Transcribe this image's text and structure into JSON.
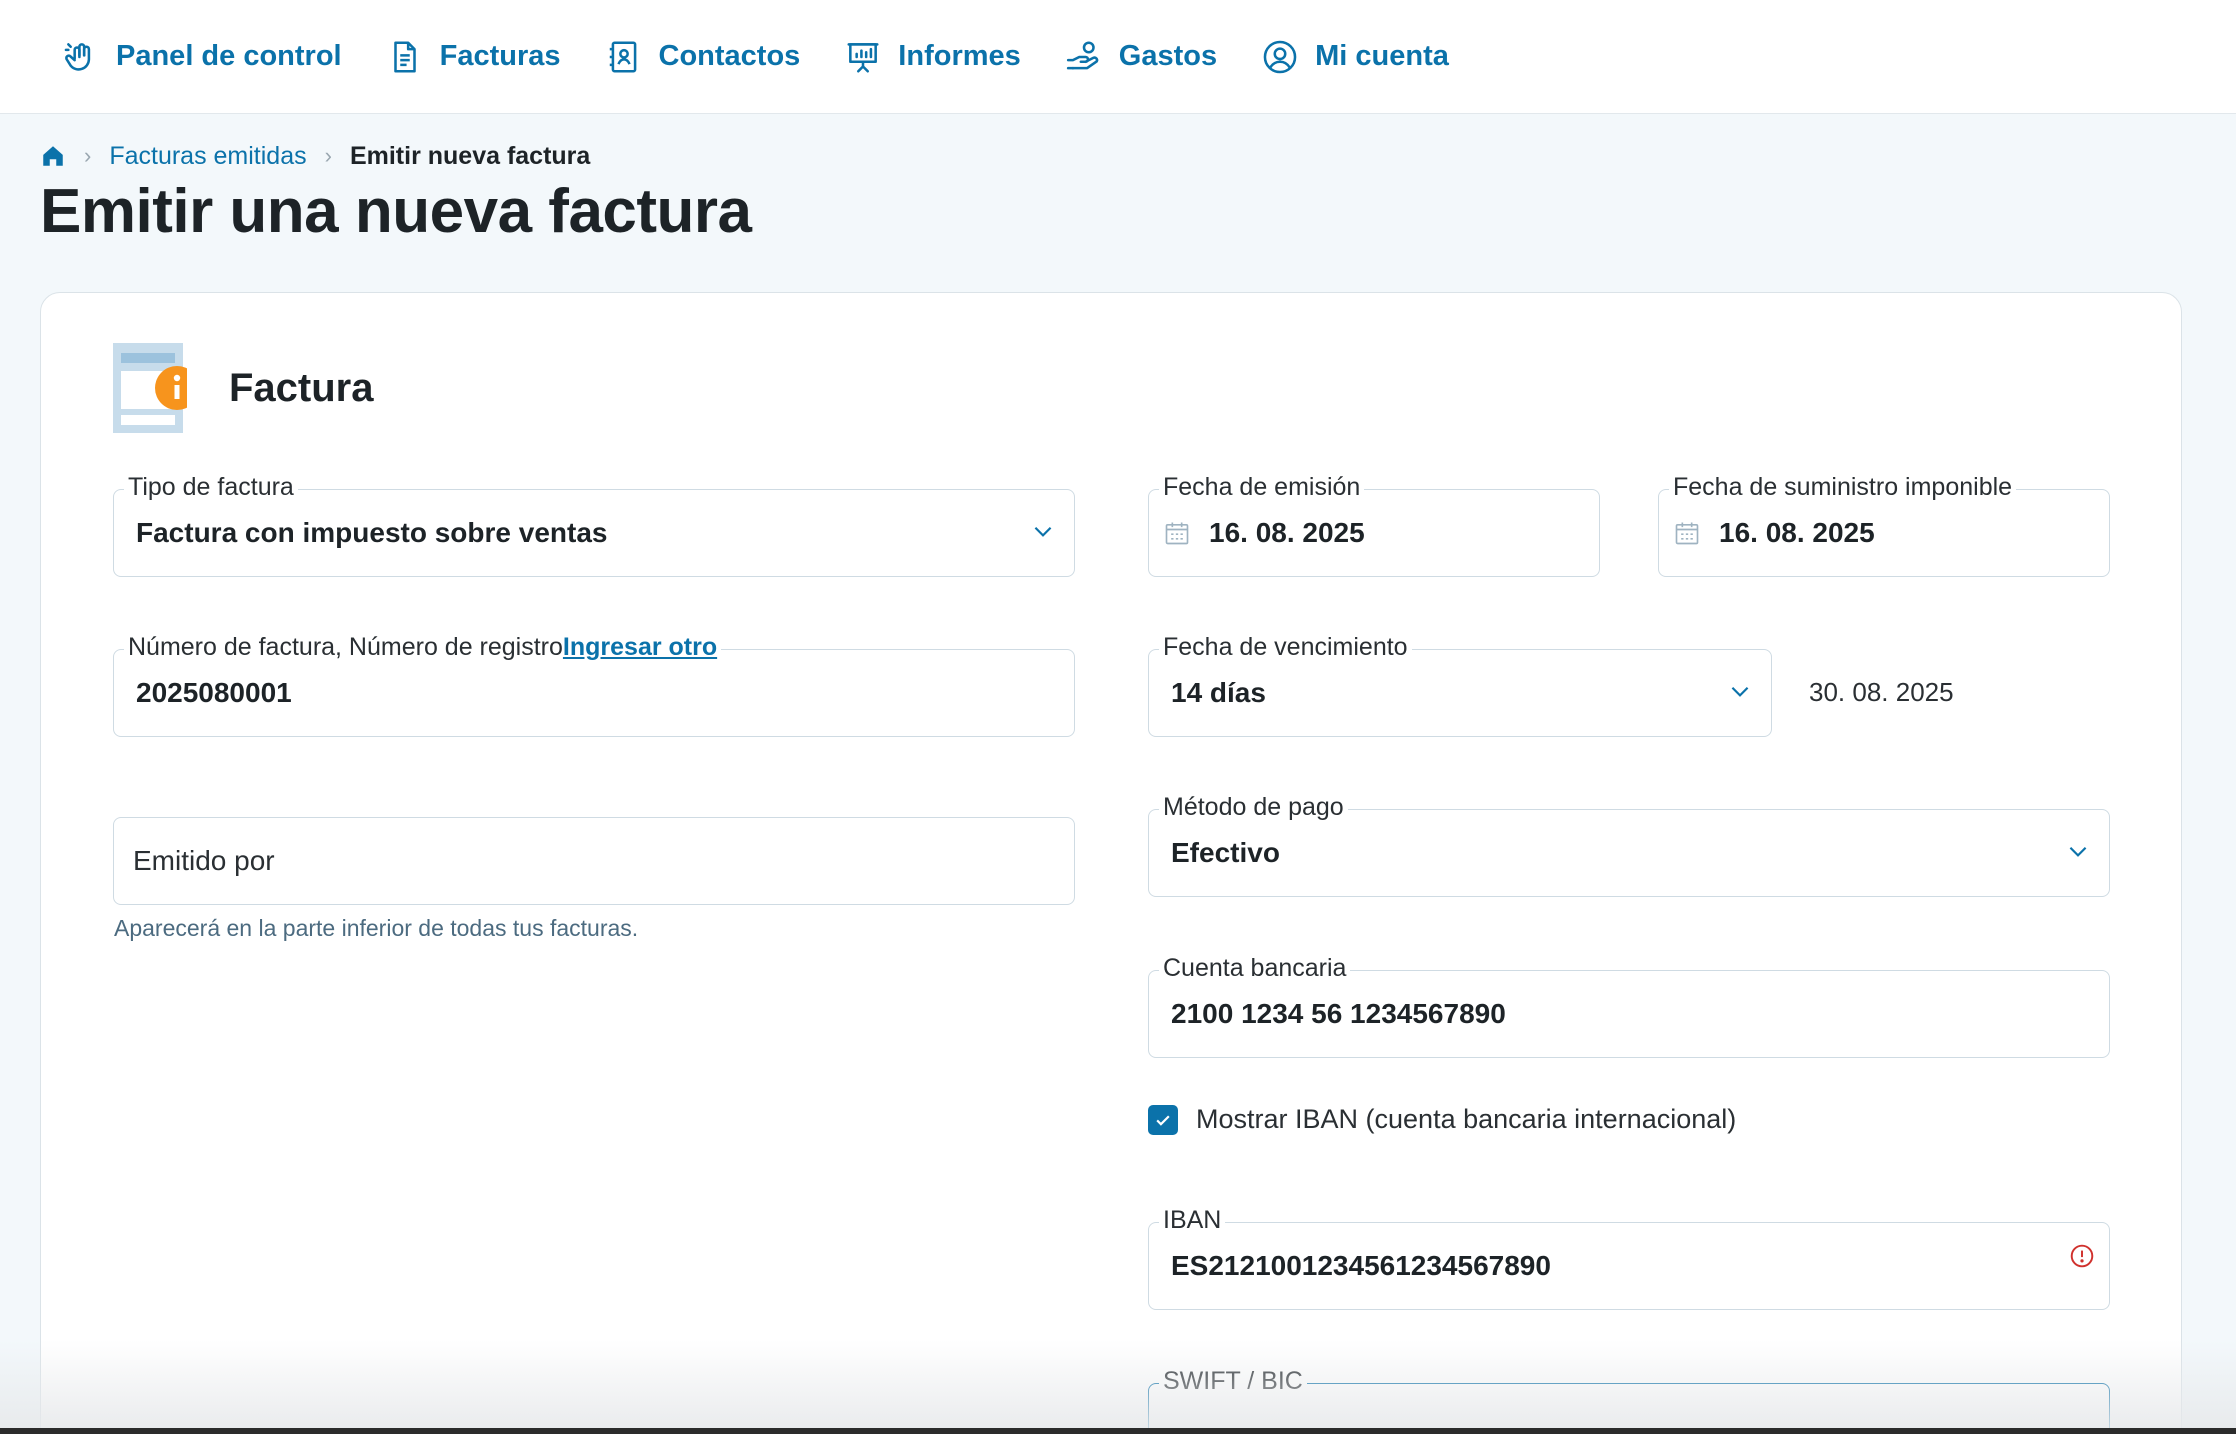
{
  "nav": {
    "items": [
      {
        "label": "Panel de control",
        "icon": "hand-wave-icon"
      },
      {
        "label": "Facturas",
        "icon": "document-icon"
      },
      {
        "label": "Contactos",
        "icon": "contact-book-icon"
      },
      {
        "label": "Informes",
        "icon": "presentation-chart-icon"
      },
      {
        "label": "Gastos",
        "icon": "hand-coin-icon"
      },
      {
        "label": "Mi cuenta",
        "icon": "user-circle-icon"
      }
    ]
  },
  "breadcrumb": {
    "parent": "Facturas emitidas",
    "current": "Emitir nueva factura"
  },
  "page_title": "Emitir una nueva factura",
  "card": {
    "title": "Factura"
  },
  "form": {
    "invoice_type": {
      "label": "Tipo de factura",
      "value": "Factura con impuesto sobre ventas"
    },
    "issue_date": {
      "label": "Fecha de emisión",
      "value": "16. 08. 2025"
    },
    "supply_date": {
      "label": "Fecha de suministro imponible",
      "value": "16. 08. 2025"
    },
    "invoice_number": {
      "label": "Número de factura, Número de registro",
      "link": "Ingresar otro",
      "value": "2025080001"
    },
    "due_date": {
      "label": "Fecha de vencimiento",
      "value": "14 días",
      "computed": "30. 08. 2025"
    },
    "issued_by": {
      "placeholder": "Emitido por",
      "hint": "Aparecerá en la parte inferior de todas tus facturas."
    },
    "payment_method": {
      "label": "Método de pago",
      "value": "Efectivo"
    },
    "bank_account": {
      "label": "Cuenta bancaria",
      "value": "2100 1234 56 1234567890"
    },
    "show_iban": {
      "label": "Mostrar IBAN (cuenta bancaria internacional)",
      "checked": true
    },
    "iban": {
      "label": "IBAN",
      "value": "ES2121001234561234567890"
    },
    "swift": {
      "label": "SWIFT / BIC",
      "value": ""
    }
  },
  "colors": {
    "accent": "#0b72aa",
    "info_badge": "#f7941d",
    "error": "#d0312d"
  }
}
